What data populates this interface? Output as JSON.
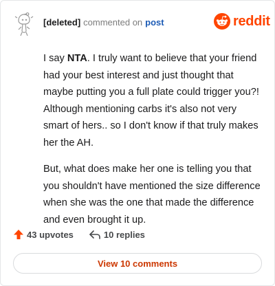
{
  "header": {
    "username": "[deleted]",
    "verb": "commented on",
    "link": "post",
    "brand": "reddit"
  },
  "comment": {
    "p1_prefix": "I say ",
    "p1_bold": "NTA",
    "p1_rest": ". I truly want to believe that your friend had your best interest and just thought that maybe putting you a full plate could trigger you?! Although mentioning carbs it's also not very smart of hers.. so I don't know if that truly makes her the AH.",
    "p2": "But, what does make her one is telling you that you shouldn't have mentioned the size difference when she was the one that made the difference and even brought it up."
  },
  "footer": {
    "upvotes": "43 upvotes",
    "replies": "10 replies",
    "view_button": "View 10 comments"
  },
  "colors": {
    "accent": "#ff4500",
    "link": "#1c5bb5",
    "button_text": "#cc3700"
  },
  "icons": [
    "deleted-user-avatar-icon",
    "reddit-logo-icon",
    "upvote-arrow-icon",
    "reply-arrow-icon"
  ]
}
